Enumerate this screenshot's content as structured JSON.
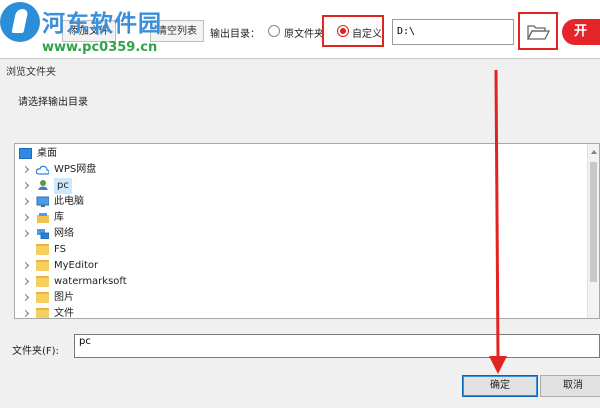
{
  "toolbar": {
    "add_file_label": "添加文件",
    "clear_list_label": "清空列表",
    "output_dir_label": "输出目录：",
    "option_original_label": "原文件夹",
    "option_custom_label": "自定义",
    "output_path_value": "D:\\",
    "start_label": "开"
  },
  "watermark": {
    "site_name": "河东软件园",
    "site_url": "www.pc0359.cn"
  },
  "dialog": {
    "title": "浏览文件夹",
    "prompt": "请选择输出目录",
    "tree": [
      {
        "label": "桌面",
        "icon": "desktop-icon"
      },
      {
        "label": "WPS网盘",
        "icon": "cloud-icon"
      },
      {
        "label": "pc",
        "icon": "user-icon"
      },
      {
        "label": "此电脑",
        "icon": "computer-icon"
      },
      {
        "label": "库",
        "icon": "library-icon"
      },
      {
        "label": "网络",
        "icon": "network-icon"
      },
      {
        "label": "FS",
        "icon": "folder-icon"
      },
      {
        "label": "MyEditor",
        "icon": "folder-icon"
      },
      {
        "label": "watermarksoft",
        "icon": "folder-icon"
      },
      {
        "label": "图片",
        "icon": "folder-icon"
      },
      {
        "label": "文件",
        "icon": "folder-icon"
      }
    ],
    "folder_label": "文件夹(F):",
    "folder_value": "pc",
    "ok_label": "确定",
    "cancel_label": "取消"
  },
  "colors": {
    "accent_red": "#e4262b",
    "annotation_red": "#e32222",
    "watermark_blue": "#3a8fd9",
    "watermark_green": "#2fa34a"
  }
}
